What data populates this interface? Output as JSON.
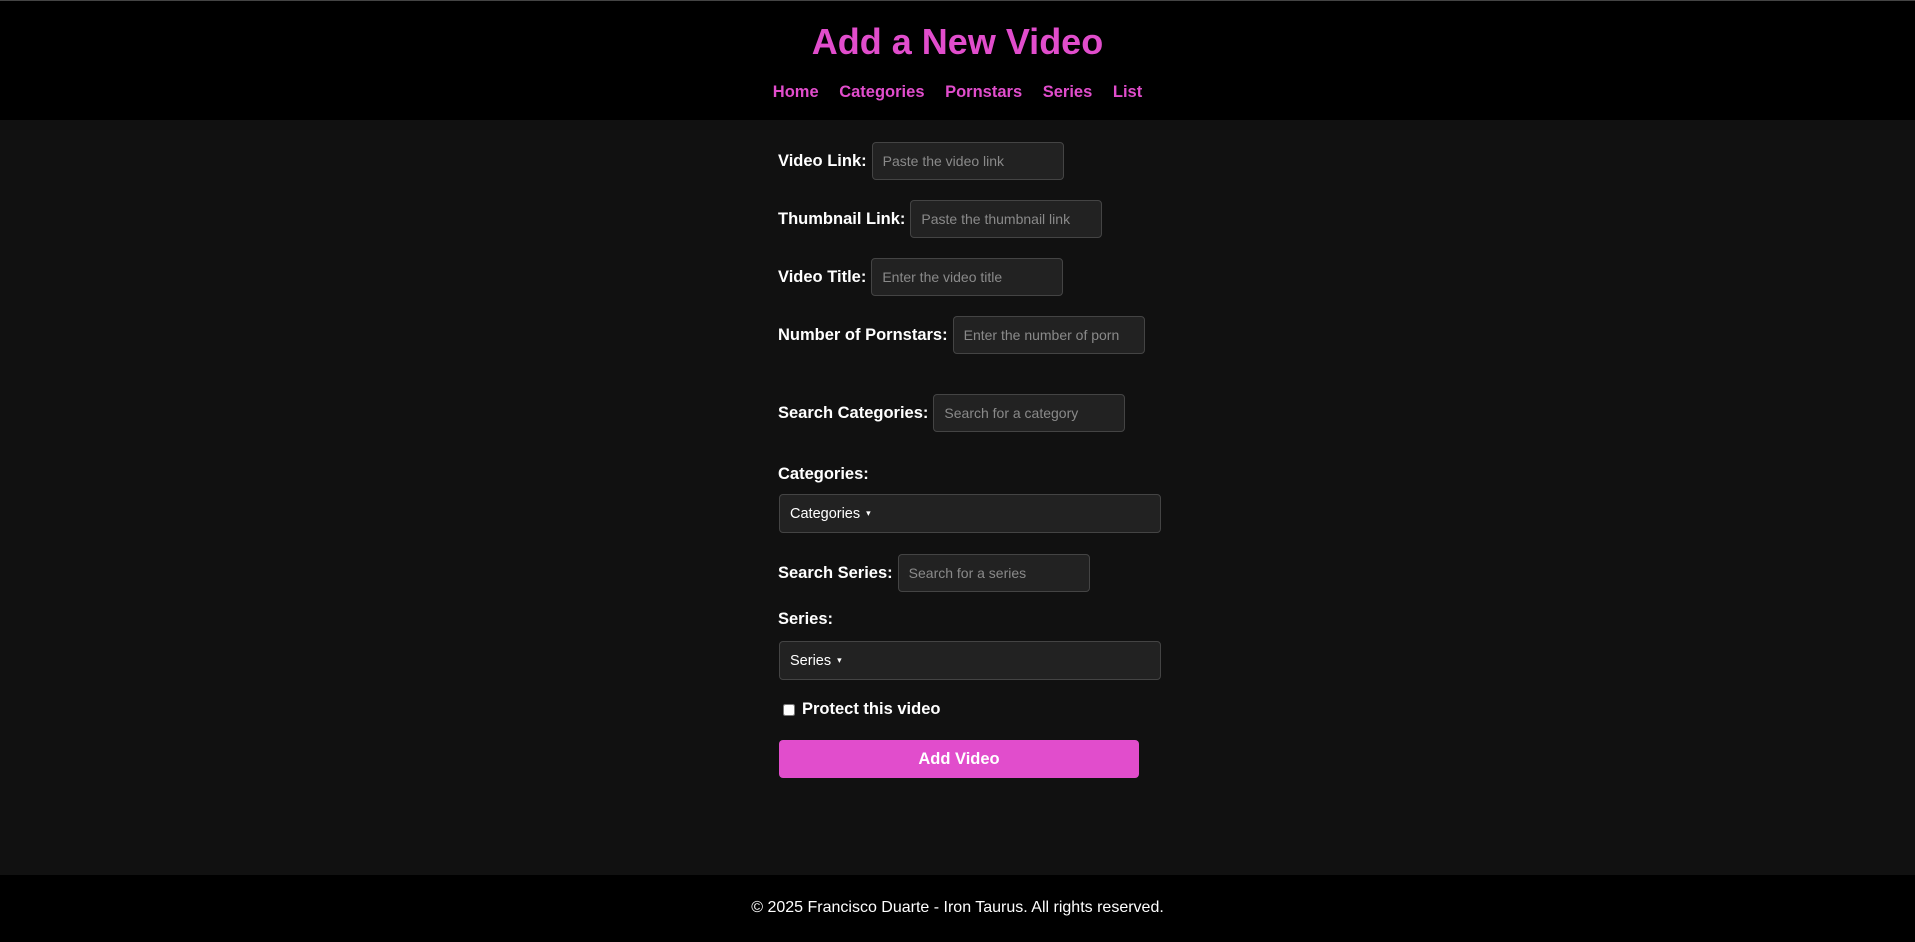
{
  "header": {
    "title": "Add a New Video",
    "nav": [
      "Home",
      "Categories",
      "Pornstars",
      "Series",
      "List"
    ]
  },
  "form": {
    "video_link": {
      "label": "Video Link:",
      "placeholder": "Paste the video link"
    },
    "thumbnail_link": {
      "label": "Thumbnail Link:",
      "placeholder": "Paste the thumbnail link"
    },
    "video_title": {
      "label": "Video Title:",
      "placeholder": "Enter the video title"
    },
    "num_pornstars": {
      "label": "Number of Pornstars:",
      "placeholder": "Enter the number of porn"
    },
    "search_categories": {
      "label": "Search Categories:",
      "placeholder": "Search for a category"
    },
    "categories": {
      "label": "Categories:",
      "dropdown": "Categories"
    },
    "search_series": {
      "label": "Search Series:",
      "placeholder": "Search for a series"
    },
    "series": {
      "label": "Series:",
      "dropdown": "Series"
    },
    "protect_label": "Protect this video",
    "protect_checked": false,
    "submit_label": "Add Video"
  },
  "caret": "▾",
  "colors": {
    "accent": "#e14dcc",
    "background": "#111111",
    "bar": "#000000",
    "input_bg": "#222222"
  },
  "footer": {
    "text": "© 2025 Francisco Duarte - Iron Taurus. All rights reserved."
  }
}
